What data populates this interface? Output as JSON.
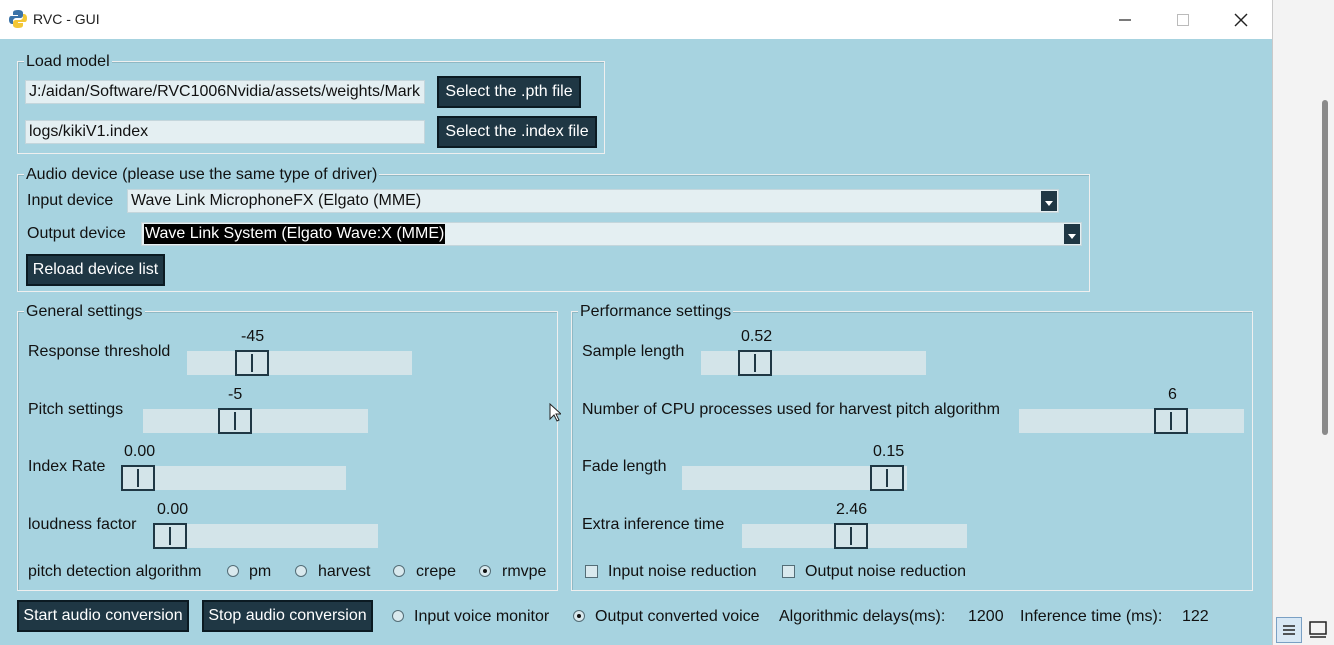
{
  "window": {
    "title": "RVC - GUI"
  },
  "load_model": {
    "legend": "Load model",
    "pth_path": "J:/aidan/Software/RVC1006Nvidia/assets/weights/Mark",
    "index_path": "logs/kikiV1.index",
    "select_pth_label": "Select the .pth file",
    "select_index_label": "Select the .index file"
  },
  "audio_device": {
    "legend": "Audio device (please use the same type of driver)",
    "input_label": "Input device",
    "input_value": "Wave Link MicrophoneFX (Elgato  (MME)",
    "output_label": "Output device",
    "output_value": "Wave Link System (Elgato Wave:X (MME)",
    "reload_label": "Reload device list"
  },
  "general": {
    "legend": "General settings",
    "response_threshold": {
      "label": "Response threshold",
      "value": "-45"
    },
    "pitch": {
      "label": "Pitch settings",
      "value": "-5"
    },
    "index_rate": {
      "label": "Index Rate",
      "value": "0.00"
    },
    "loudness": {
      "label": "loudness factor",
      "value": "0.00"
    },
    "pitch_algo": {
      "label": "pitch detection algorithm",
      "options": [
        "pm",
        "harvest",
        "crepe",
        "rmvpe"
      ],
      "selected": "rmvpe"
    }
  },
  "performance": {
    "legend": "Performance settings",
    "sample_length": {
      "label": "Sample length",
      "value": "0.52"
    },
    "cpu_processes": {
      "label": "Number of CPU processes used for harvest pitch algorithm",
      "value": "6"
    },
    "fade_length": {
      "label": "Fade length",
      "value": "0.15"
    },
    "extra_inference": {
      "label": "Extra inference time",
      "value": "2.46"
    },
    "input_noise_label": "Input noise reduction",
    "output_noise_label": "Output noise reduction"
  },
  "footer": {
    "start_label": "Start audio conversion",
    "stop_label": "Stop audio conversion",
    "monitor_input_label": "Input voice monitor",
    "monitor_output_label": "Output converted voice",
    "delay_label": "Algorithmic delays(ms):",
    "delay_value": "1200",
    "inference_label": "Inference time (ms):",
    "inference_value": "122"
  },
  "colors": {
    "background": "#a7d3e0",
    "button": "#1f3744",
    "field": "#e4eff2"
  }
}
